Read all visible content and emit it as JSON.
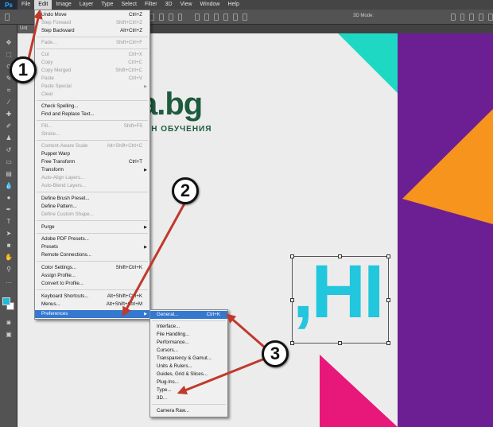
{
  "app": {
    "logo": "Ps"
  },
  "menubar": {
    "items": [
      "File",
      "Edit",
      "Image",
      "Layer",
      "Type",
      "Select",
      "Filter",
      "3D",
      "View",
      "Window",
      "Help"
    ],
    "active": "Edit"
  },
  "optionsbar": {
    "mode_label": "3D Mode:"
  },
  "document_tab": {
    "label": "Unt"
  },
  "tools": {
    "foreground_color": "#22b9d8",
    "background_color": "#ffffff"
  },
  "canvas": {
    "logo_text": "a.bg",
    "logo_subtitle": "ИН ОБУЧЕНИЯ",
    "headline_text": ",HI",
    "colors": {
      "purple": "#6b1f93",
      "orange": "#f7941d",
      "teal": "#1fd8c4",
      "pink": "#e8177a",
      "cyan_text": "#22c6dd",
      "logo_green": "#1d5b3e"
    }
  },
  "edit_menu": {
    "items": [
      {
        "label": "Undo Move",
        "shortcut": "Ctrl+Z",
        "enabled": true
      },
      {
        "label": "Step Forward",
        "shortcut": "Shift+Ctrl+Z",
        "enabled": false
      },
      {
        "label": "Step Backward",
        "shortcut": "Alt+Ctrl+Z",
        "enabled": true
      },
      {
        "label": "Fade...",
        "shortcut": "Shift+Ctrl+F",
        "enabled": false
      },
      {
        "label": "Cut",
        "shortcut": "Ctrl+X",
        "enabled": false
      },
      {
        "label": "Copy",
        "shortcut": "Ctrl+C",
        "enabled": false
      },
      {
        "label": "Copy Merged",
        "shortcut": "Shift+Ctrl+C",
        "enabled": false
      },
      {
        "label": "Paste",
        "shortcut": "Ctrl+V",
        "enabled": false
      },
      {
        "label": "Paste Special",
        "shortcut": "",
        "enabled": false,
        "submenu": true
      },
      {
        "label": "Clear",
        "shortcut": "",
        "enabled": false
      },
      {
        "label": "Check Spelling...",
        "shortcut": "",
        "enabled": true
      },
      {
        "label": "Find and Replace Text...",
        "shortcut": "",
        "enabled": true
      },
      {
        "label": "Fill...",
        "shortcut": "Shift+F5",
        "enabled": false
      },
      {
        "label": "Stroke...",
        "shortcut": "",
        "enabled": false
      },
      {
        "label": "Content-Aware Scale",
        "shortcut": "Alt+Shift+Ctrl+C",
        "enabled": false
      },
      {
        "label": "Puppet Warp",
        "shortcut": "",
        "enabled": true
      },
      {
        "label": "Free Transform",
        "shortcut": "Ctrl+T",
        "enabled": true
      },
      {
        "label": "Transform",
        "shortcut": "",
        "enabled": true,
        "submenu": true
      },
      {
        "label": "Auto-Align Layers...",
        "shortcut": "",
        "enabled": false
      },
      {
        "label": "Auto-Blend Layers...",
        "shortcut": "",
        "enabled": false
      },
      {
        "label": "Define Brush Preset...",
        "shortcut": "",
        "enabled": true
      },
      {
        "label": "Define Pattern...",
        "shortcut": "",
        "enabled": true
      },
      {
        "label": "Define Custom Shape...",
        "shortcut": "",
        "enabled": false
      },
      {
        "label": "Purge",
        "shortcut": "",
        "enabled": true,
        "submenu": true
      },
      {
        "label": "Adobe PDF Presets...",
        "shortcut": "",
        "enabled": true
      },
      {
        "label": "Presets",
        "shortcut": "",
        "enabled": true,
        "submenu": true
      },
      {
        "label": "Remote Connections...",
        "shortcut": "",
        "enabled": true
      },
      {
        "label": "Color Settings...",
        "shortcut": "Shift+Ctrl+K",
        "enabled": true
      },
      {
        "label": "Assign Profile...",
        "shortcut": "",
        "enabled": true
      },
      {
        "label": "Convert to Profile...",
        "shortcut": "",
        "enabled": true
      },
      {
        "label": "Keyboard Shortcuts...",
        "shortcut": "Alt+Shift+Ctrl+K",
        "enabled": true
      },
      {
        "label": "Menus...",
        "shortcut": "Alt+Shift+Ctrl+M",
        "enabled": true
      },
      {
        "label": "Preferences",
        "shortcut": "",
        "enabled": true,
        "submenu": true,
        "highlighted": true
      }
    ]
  },
  "preferences_menu": {
    "items": [
      {
        "label": "General...",
        "shortcut": "Ctrl+K",
        "highlighted": true
      },
      {
        "label": "Interface...",
        "shortcut": ""
      },
      {
        "label": "File Handling...",
        "shortcut": ""
      },
      {
        "label": "Performance...",
        "shortcut": ""
      },
      {
        "label": "Cursors...",
        "shortcut": ""
      },
      {
        "label": "Transparency & Gamut...",
        "shortcut": ""
      },
      {
        "label": "Units & Rulers...",
        "shortcut": ""
      },
      {
        "label": "Guides, Grid & Slices...",
        "shortcut": ""
      },
      {
        "label": "Plug-Ins...",
        "shortcut": ""
      },
      {
        "label": "Type...",
        "shortcut": ""
      },
      {
        "label": "3D...",
        "shortcut": ""
      },
      {
        "label": "Camera Raw...",
        "shortcut": ""
      }
    ]
  },
  "annotations": {
    "step1": "1",
    "step2": "2",
    "step3": "3",
    "arrow_color": "#c0392b"
  }
}
